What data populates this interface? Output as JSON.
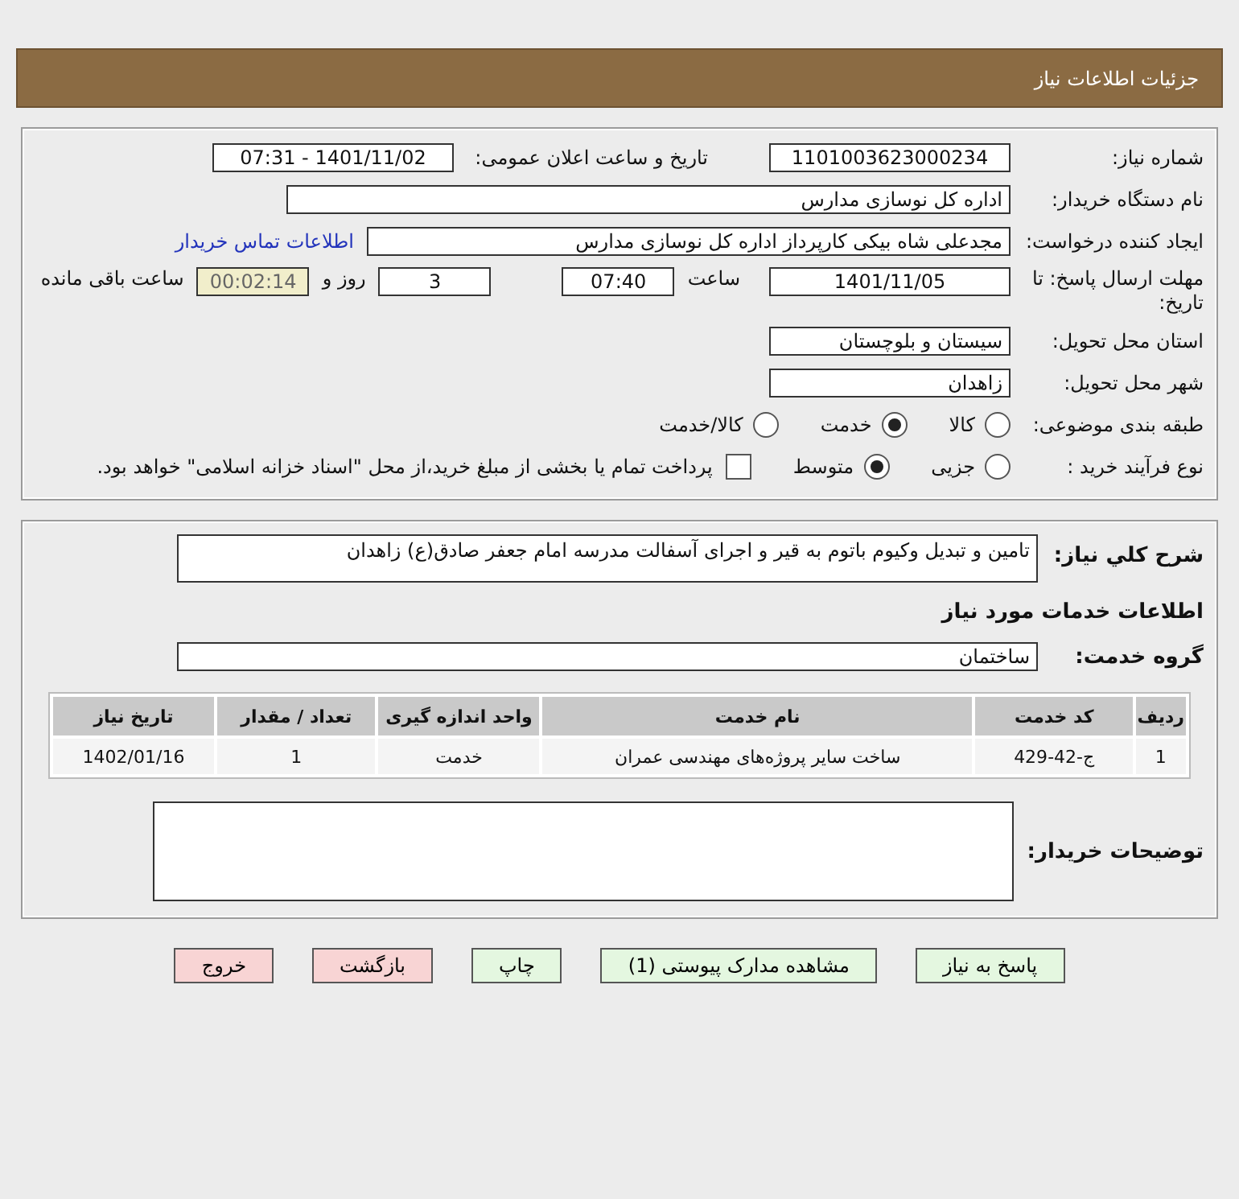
{
  "header": {
    "title": "جزئیات اطلاعات نیاز"
  },
  "details": {
    "need_number": {
      "label": "شماره نیاز:",
      "value": "1101003623000234"
    },
    "announce": {
      "label": "تاریخ و ساعت اعلان عمومی:",
      "value": "1401/11/02 - 07:31"
    },
    "buyer_org": {
      "label": "نام دستگاه خریدار:",
      "value": "اداره کل نوسازی مدارس"
    },
    "requester": {
      "label": "ایجاد کننده درخواست:",
      "value": "مجدعلی شاه بیکی کارپرداز اداره کل نوسازی مدارس",
      "link": "اطلاعات تماس خریدار"
    },
    "deadline": {
      "label": "مهلت ارسال پاسخ: تا تاریخ:",
      "date": "1401/11/05",
      "time_label": "ساعت",
      "time": "07:40",
      "days": "3",
      "days_label": "روز و",
      "remaining": "00:02:14",
      "remaining_label": "ساعت باقی مانده"
    },
    "province": {
      "label": "استان محل تحویل:",
      "value": "سیستان و بلوچستان"
    },
    "city": {
      "label": "شهر محل تحویل:",
      "value": "زاهدان"
    },
    "category": {
      "label": "طبقه بندی موضوعی:",
      "options": [
        {
          "label": "کالا",
          "selected": false
        },
        {
          "label": "خدمت",
          "selected": true
        },
        {
          "label": "کالا/خدمت",
          "selected": false
        }
      ]
    },
    "process": {
      "label": "نوع فرآیند خرید :",
      "options": [
        {
          "label": "جزیی",
          "selected": false
        },
        {
          "label": "متوسط",
          "selected": true
        }
      ],
      "payment": {
        "checked": false,
        "text": "پرداخت تمام یا بخشی از مبلغ خرید،از محل \"اسناد خزانه اسلامی\" خواهد بود."
      }
    }
  },
  "summary": {
    "label": "شرح کلي نياز:",
    "value": "تامین و تبدیل وکیوم باتوم به قیر و اجرای آسفالت مدرسه امام جعفر صادق(ع) زاهدان"
  },
  "services_title": "اطلاعات خدمات مورد نیاز",
  "service_group": {
    "label": "گروه خدمت:",
    "value": "ساختمان"
  },
  "table": {
    "columns": [
      "ردیف",
      "کد خدمت",
      "نام خدمت",
      "واحد اندازه گیری",
      "تعداد / مقدار",
      "تاریخ نیاز"
    ],
    "rows": [
      [
        "1",
        "ج-42-429",
        "ساخت سایر پروژه‌های مهندسی عمران",
        "خدمت",
        "1",
        "1402/01/16"
      ]
    ]
  },
  "buyer_notes": {
    "label": "توضیحات خریدار:"
  },
  "buttons": [
    {
      "label": "پاسخ به نیاز",
      "kind": "normal"
    },
    {
      "label": "مشاهده مدارک پیوستی (1)",
      "kind": "normal"
    },
    {
      "label": "چاپ",
      "kind": "normal"
    },
    {
      "label": "بازگشت",
      "kind": "danger"
    },
    {
      "label": "خروج",
      "kind": "danger"
    }
  ]
}
